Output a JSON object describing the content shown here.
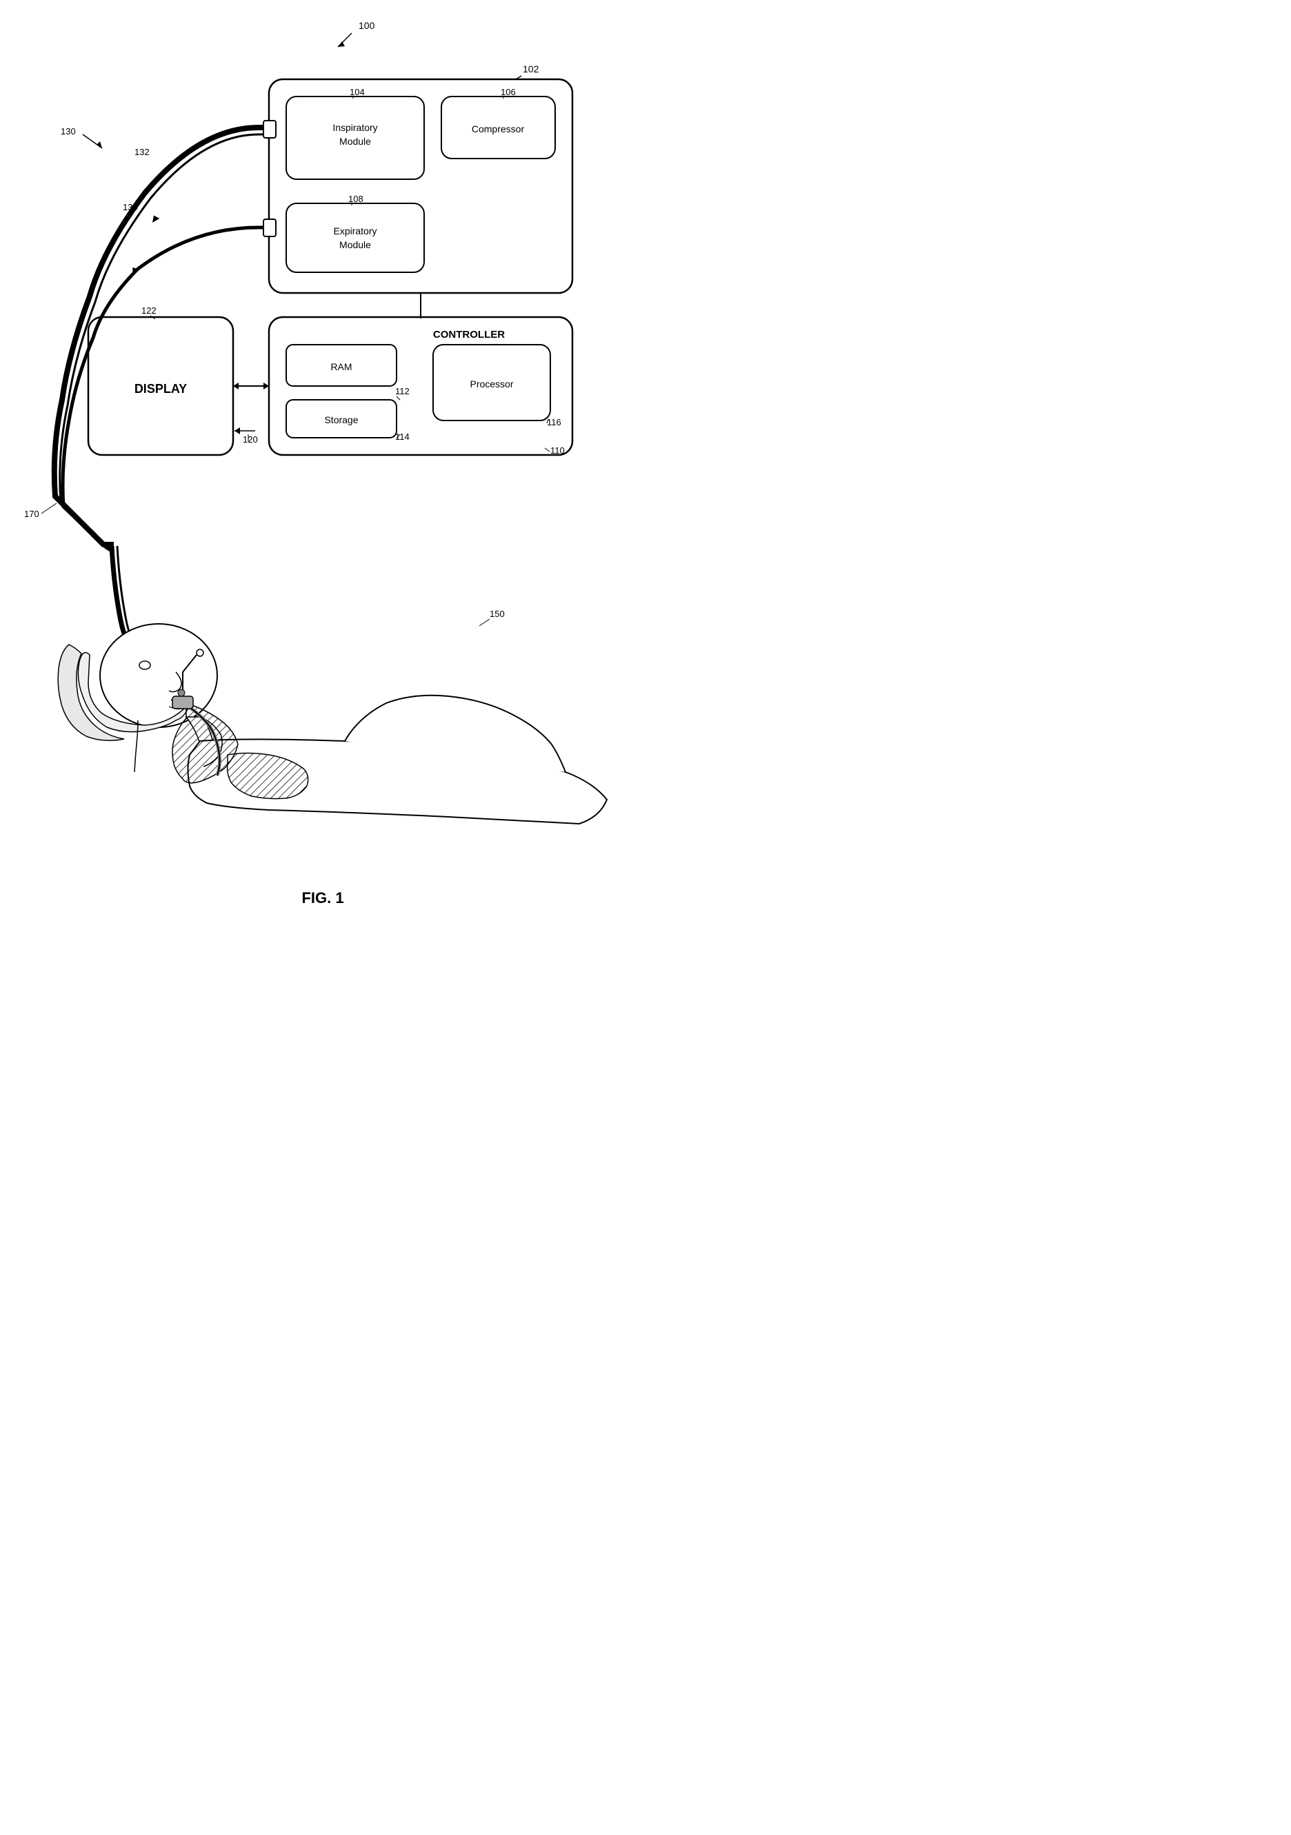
{
  "diagram": {
    "title": "FIG. 1",
    "reference_numbers": {
      "n100": "100",
      "n102": "102",
      "n104": "104",
      "n106": "106",
      "n108": "108",
      "n110": "110",
      "n112": "112",
      "n114": "114",
      "n116": "116",
      "n120": "120",
      "n122": "122",
      "n130": "130",
      "n132": "132",
      "n134": "134",
      "n150": "150",
      "n170": "170"
    },
    "labels": {
      "inspiratory_module": "Inspiratory\nModule",
      "compressor": "Compressor",
      "expiratory_module": "Expiratory\nModule",
      "controller": "CONTROLLER",
      "ram": "RAM",
      "storage": "Storage",
      "processor": "Processor",
      "display": "DISPLAY",
      "fig": "FIG. 1"
    }
  }
}
